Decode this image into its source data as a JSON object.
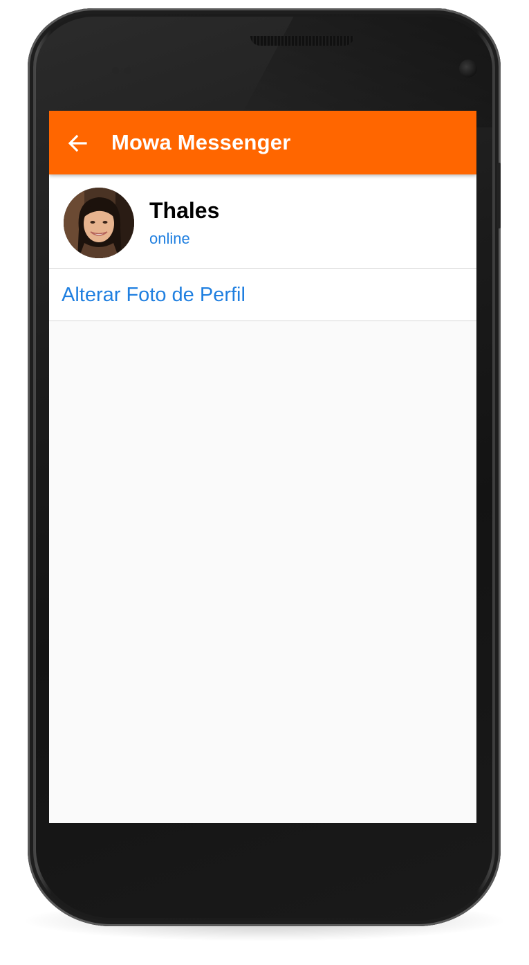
{
  "app_bar": {
    "title": "Mowa Messenger",
    "back_icon": "arrow-left-icon",
    "color": "#ff6600"
  },
  "profile": {
    "name": "Thales",
    "status": "online",
    "status_color": "#1f7fe0"
  },
  "actions": {
    "change_photo_label": "Alterar Foto de Perfil",
    "link_color": "#1f7fe0"
  }
}
